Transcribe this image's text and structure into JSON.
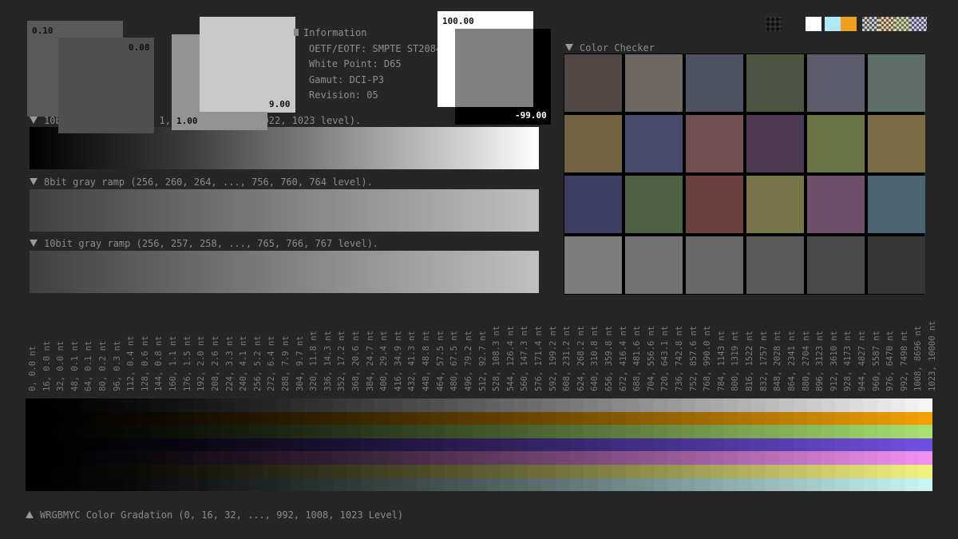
{
  "patches": {
    "p010": "0.10",
    "p008": "0.08",
    "p100": "1.00",
    "p900": "9.00",
    "p10000": "100.00",
    "pm9900": "-99.00"
  },
  "info": {
    "header": "Information",
    "lines": [
      "OETF/EOTF: SMPTE ST2084",
      "White Point: D65",
      "Gamut: DCI-P3",
      "Revision: 05"
    ]
  },
  "ramps": {
    "ramp1_label": "10bit gray ramp (0, 1, 2, ..., 1021, 1022, 1023 level).",
    "ramp2_label": "8bit gray ramp (256, 260, 264, ..., 756, 760, 764 level).",
    "ramp3_label": "10bit gray ramp (256, 257, 258, ..., 765, 766, 767 level)."
  },
  "color_checker": {
    "title": "Color Checker",
    "colors": [
      "#514843",
      "#6e6660",
      "#4d5360",
      "#4e5442",
      "#5d5c6d",
      "#5e6d67",
      "#756242",
      "#4a4c6e",
      "#6f4f52",
      "#4b3a50",
      "#6a7447",
      "#7b6c44",
      "#3e3f63",
      "#4d6143",
      "#6a413c",
      "#787548",
      "#6f5068",
      "#4c6572",
      "#7c7c7c",
      "#727272",
      "#676767",
      "#5b5b5b",
      "#4a4a4a",
      "#373737"
    ]
  },
  "nits": {
    "levels": [
      "0",
      "16",
      "32",
      "48",
      "64",
      "80",
      "96",
      "112",
      "128",
      "144",
      "160",
      "176",
      "192",
      "208",
      "224",
      "240",
      "256",
      "272",
      "288",
      "304",
      "320",
      "336",
      "352",
      "368",
      "384",
      "400",
      "416",
      "432",
      "448",
      "464",
      "480",
      "496",
      "512",
      "528",
      "544",
      "560",
      "576",
      "592",
      "608",
      "624",
      "640",
      "656",
      "672",
      "688",
      "704",
      "720",
      "736",
      "752",
      "768",
      "784",
      "800",
      "816",
      "832",
      "848",
      "864",
      "880",
      "896",
      "912",
      "928",
      "944",
      "960",
      "976",
      "992",
      "1008",
      "1023"
    ],
    "values": [
      "0.0 nt",
      "0.0 nt",
      "0.0 nt",
      "0.1 nt",
      "0.1 nt",
      "0.2 nt",
      "0.3 nt",
      "0.4 nt",
      "0.6 nt",
      "0.8 nt",
      "1.1 nt",
      "1.5 nt",
      "2.0 nt",
      "2.6 nt",
      "3.3 nt",
      "4.1 nt",
      "5.2 nt",
      "6.4 nt",
      "7.9 nt",
      "9.7 nt",
      "11.8 nt",
      "14.3 nt",
      "17.2 nt",
      "20.6 nt",
      "24.7 nt",
      "29.4 nt",
      "34.9 nt",
      "41.3 nt",
      "48.8 nt",
      "57.5 nt",
      "67.5 nt",
      "79.2 nt",
      "92.7 nt",
      "108.3 nt",
      "126.4 nt",
      "147.3 nt",
      "171.4 nt",
      "199.2 nt",
      "231.2 nt",
      "268.2 nt",
      "310.8 nt",
      "359.8 nt",
      "416.4 nt",
      "481.6 nt",
      "556.6 nt",
      "643.1 nt",
      "742.8 nt",
      "857.6 nt",
      "990.0 nt",
      "1143 nt",
      "1319 nt",
      "1522 nt",
      "1757 nt",
      "2028 nt",
      "2341 nt",
      "2704 nt",
      "3123 nt",
      "3610 nt",
      "4173 nt",
      "4827 nt",
      "5587 nt",
      "6470 nt",
      "7498 nt",
      "8696 nt",
      "10000 nt"
    ]
  },
  "gradation": {
    "label": "WRGBMYC Color Gradation (0, 16, 32, ..., 992, 1008, 1023 Level)",
    "rows": [
      {
        "name": "white",
        "end": "#f5f5f5"
      },
      {
        "name": "red",
        "end": "#f0a000"
      },
      {
        "name": "green",
        "end": "#a8e070"
      },
      {
        "name": "blue",
        "end": "#7050e0"
      },
      {
        "name": "magenta",
        "end": "#f090f0"
      },
      {
        "name": "yellow",
        "end": "#f2f080"
      },
      {
        "name": "cyan",
        "end": "#c8f4f4"
      }
    ]
  },
  "swatches": {
    "colors": [
      "#ffffff",
      "#b0e8f8",
      "#f0a020"
    ]
  }
}
